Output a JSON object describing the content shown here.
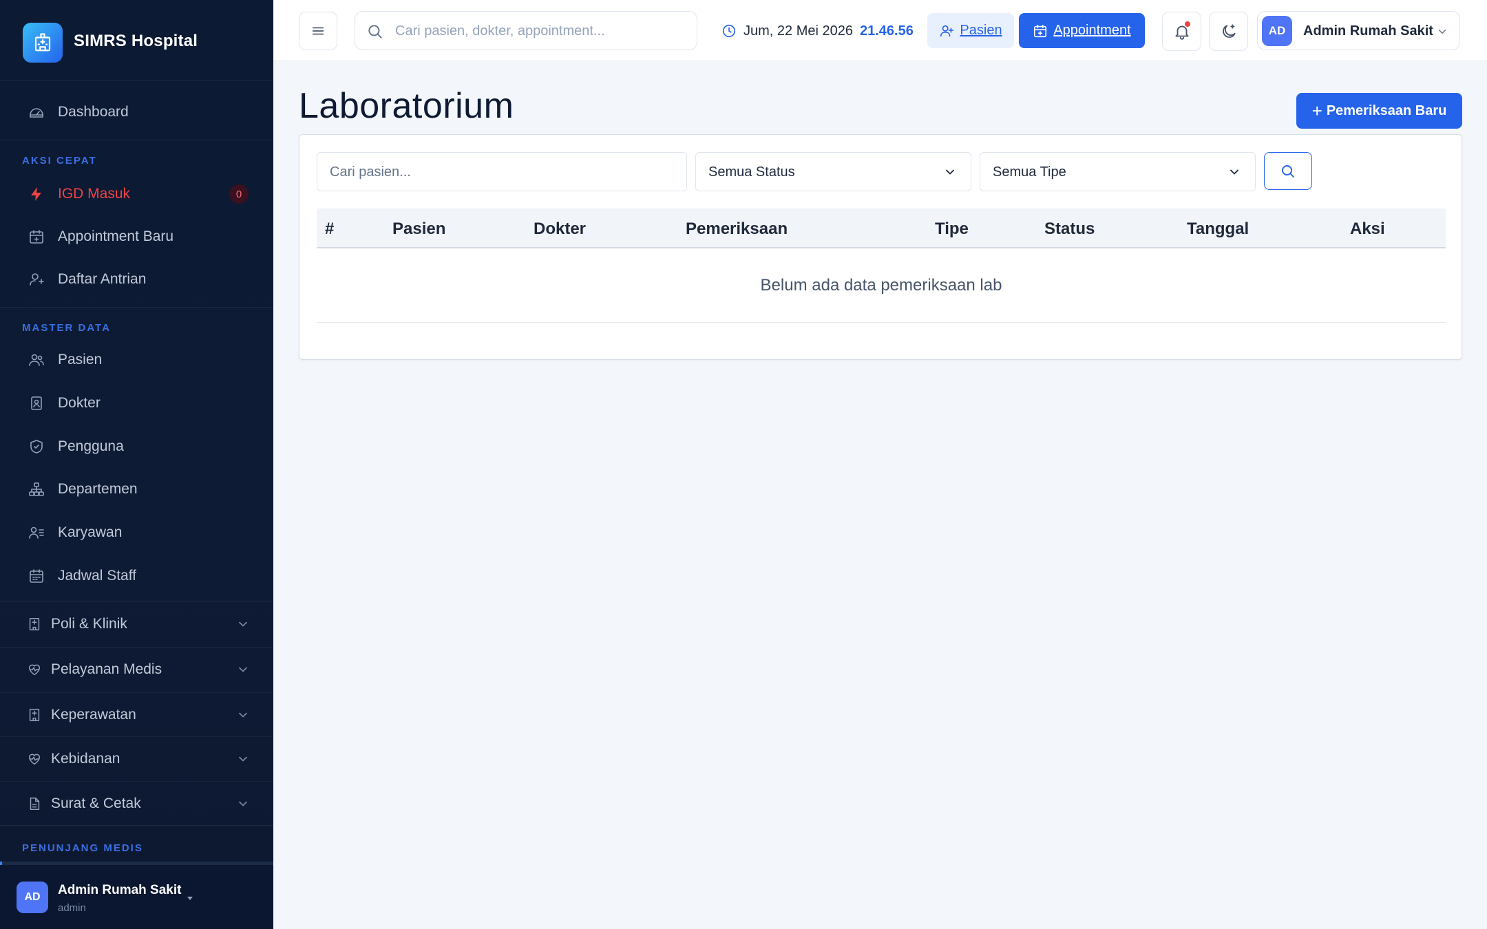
{
  "app": {
    "name": "SIMRS Hospital"
  },
  "sidebar": {
    "dashboard": "Dashboard",
    "sections": {
      "aksi_cepat": "AKSI CEPAT",
      "master_data": "MASTER DATA",
      "penunjang_medis": "PENUNJANG MEDIS"
    },
    "quick_actions": [
      {
        "label": "IGD Masuk",
        "badge": "0"
      },
      {
        "label": "Appointment Baru"
      },
      {
        "label": "Daftar Antrian"
      }
    ],
    "master_items": [
      {
        "label": "Pasien"
      },
      {
        "label": "Dokter"
      },
      {
        "label": "Pengguna"
      },
      {
        "label": "Departemen"
      },
      {
        "label": "Karyawan"
      },
      {
        "label": "Jadwal Staff"
      }
    ],
    "groups": [
      {
        "label": "Poli & Klinik"
      },
      {
        "label": "Pelayanan Medis"
      },
      {
        "label": "Keperawatan"
      },
      {
        "label": "Kebidanan"
      },
      {
        "label": "Surat & Cetak"
      }
    ],
    "user": {
      "initials": "AD",
      "name": "Admin Rumah Sakit",
      "role": "admin"
    }
  },
  "topbar": {
    "search_placeholder": "Cari pasien, dokter, appointment...",
    "date": "Jum, 22 Mei 2026",
    "time": "21.46.56",
    "pasien_button": "Pasien",
    "appointment_button": "Appointment",
    "profile": {
      "initials": "AD",
      "name": "Admin Rumah Sakit"
    }
  },
  "page": {
    "title": "Laboratorium",
    "new_button": "Pemeriksaan Baru",
    "filters": {
      "search_placeholder": "Cari pasien...",
      "status_value": "Semua Status",
      "type_value": "Semua Tipe"
    },
    "table": {
      "columns": [
        "#",
        "Pasien",
        "Dokter",
        "Pemeriksaan",
        "Tipe",
        "Status",
        "Tanggal",
        "Aksi"
      ],
      "empty_message": "Belum ada data pemeriksaan lab"
    }
  },
  "colors": {
    "accent": "#2563eb",
    "sidebar_bg": "#0c1a33",
    "section_title": "#3b6fe0",
    "danger": "#ef4444"
  }
}
